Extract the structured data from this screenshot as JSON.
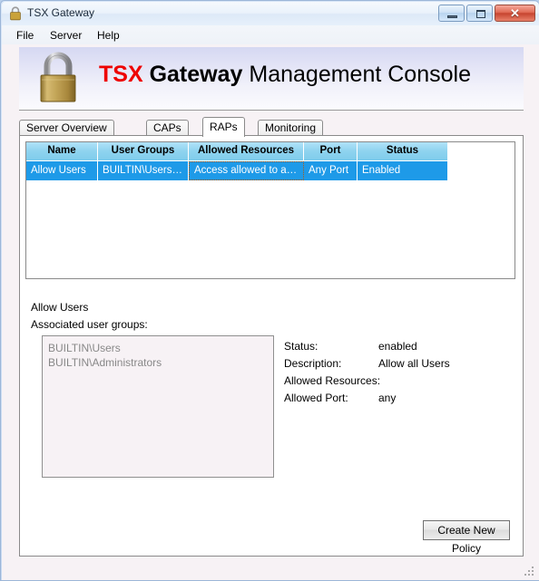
{
  "window": {
    "title": "TSX Gateway",
    "icon": "padlock-icon",
    "buttons": {
      "minimize": "minimize-icon",
      "maximize": "maximize-icon",
      "close": "✕"
    }
  },
  "menubar": {
    "items": [
      {
        "label": "File"
      },
      {
        "label": "Server"
      },
      {
        "label": "Help"
      }
    ]
  },
  "banner": {
    "icon": "padlock-icon",
    "title_part1": "TSX",
    "title_part2": "Gateway",
    "title_part3": "Management Console",
    "accent_color": "#ee0000"
  },
  "tabs": [
    {
      "label": "Server Overview",
      "active": false
    },
    {
      "label": "CAPs",
      "active": false
    },
    {
      "label": "RAPs",
      "active": true
    },
    {
      "label": "Monitoring",
      "active": false
    }
  ],
  "grid": {
    "columns": [
      "Name",
      "User Groups",
      "Allowed Resources",
      "Port",
      "Status"
    ],
    "rows": [
      {
        "name": "Allow Users",
        "user_groups": "BUILTIN\\Users;...",
        "allowed_resources": "Access allowed to all ...",
        "port": "Any Port",
        "status": "Enabled",
        "selected": true
      }
    ],
    "selection_color": "#1e9ae8",
    "header_color": "#8ed3ef"
  },
  "details": {
    "policy_name": "Allow Users",
    "groups_label": "Associated user groups:",
    "groups": [
      "BUILTIN\\Users",
      "BUILTIN\\Administrators"
    ],
    "fields": [
      {
        "label": "Status:",
        "value": "enabled"
      },
      {
        "label": "Description:",
        "value": "Allow all Users"
      },
      {
        "label": "Allowed Resources:",
        "value": ""
      },
      {
        "label": "Allowed Port:",
        "value": "any"
      }
    ]
  },
  "actions": {
    "create_new_policy": "Create New Policy"
  }
}
